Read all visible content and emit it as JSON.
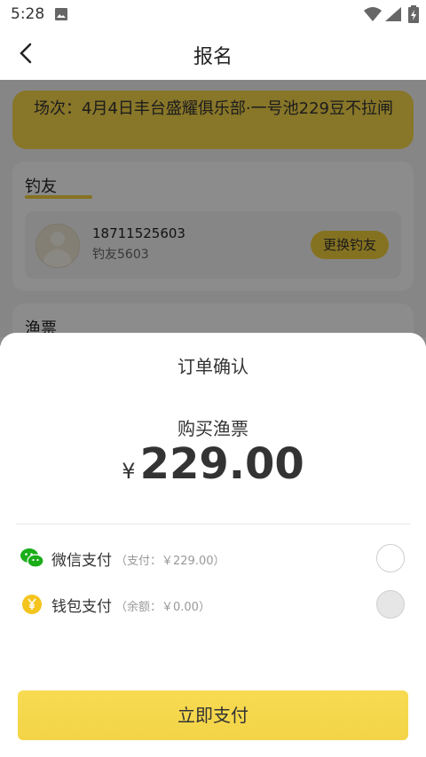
{
  "status_bar": {
    "time": "5:28"
  },
  "nav": {
    "title": "报名"
  },
  "session": {
    "text": "场次：4月4日丰台盛耀俱乐部·一号池229豆不拉闸"
  },
  "friend_card": {
    "heading": "钓友",
    "phone": "18711525603",
    "nickname": "钓友5603",
    "change_label": "更换钓友"
  },
  "ticket_card": {
    "heading": "渔票"
  },
  "sheet": {
    "title": "订单确认",
    "buy_label": "购买渔票",
    "currency": "¥",
    "amount": "229.00",
    "wechat": {
      "name": "微信支付",
      "note": "（支付：￥229.00）"
    },
    "wallet": {
      "name": "钱包支付",
      "note": "（余额：￥0.00）"
    },
    "pay_label": "立即支付"
  },
  "colors": {
    "accent": "#f3cf3c",
    "wechat_green": "#1aad19",
    "wallet_yellow": "#f4c41d"
  }
}
